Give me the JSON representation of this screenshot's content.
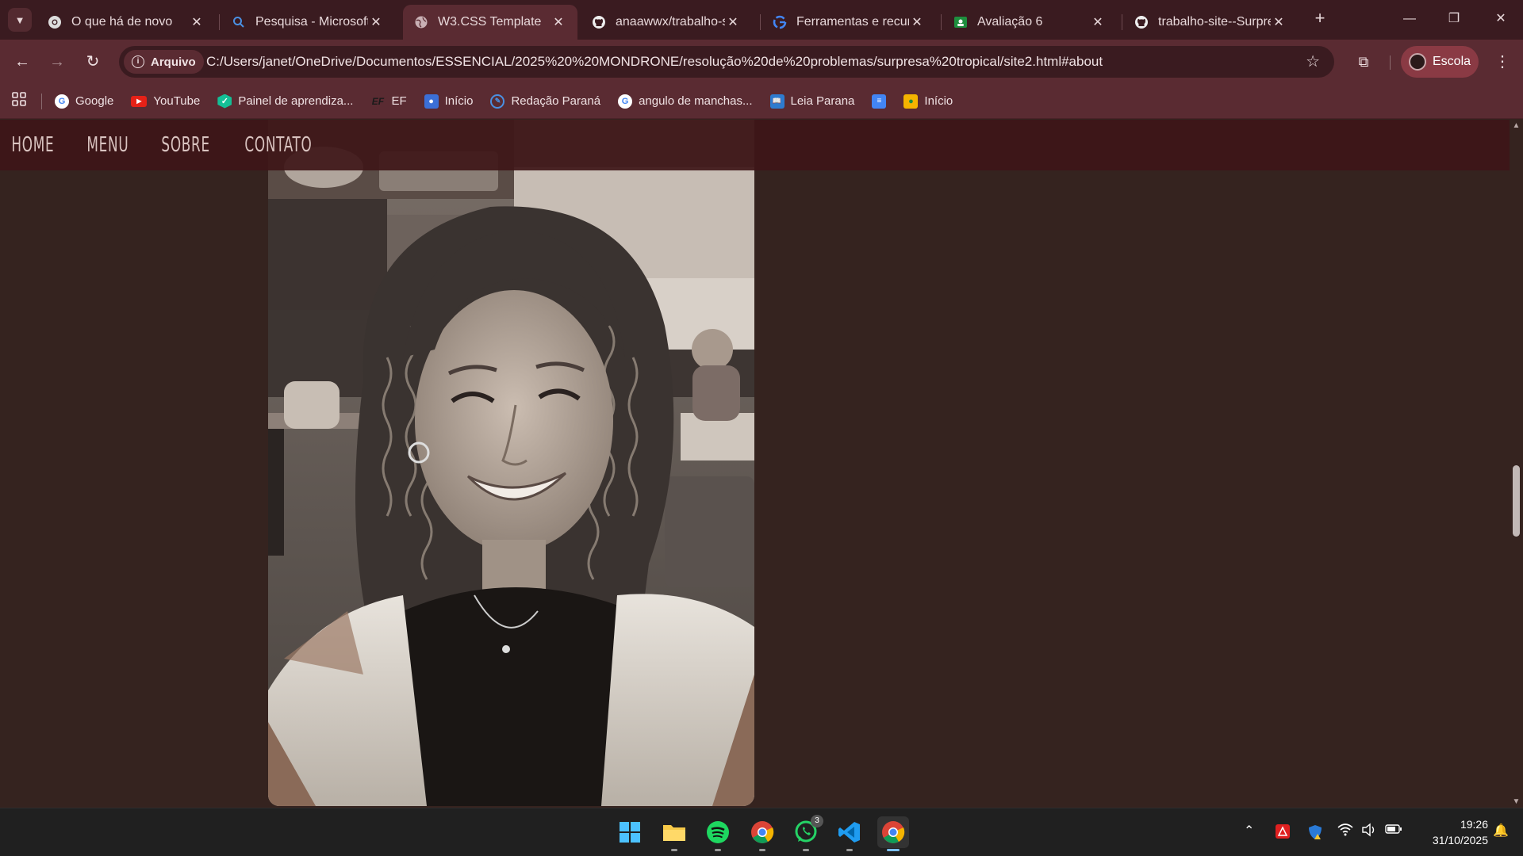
{
  "browser": {
    "tabs": [
      {
        "title": "O que há de novo",
        "favicon": "chrome-icon",
        "active": false
      },
      {
        "title": "Pesquisa - Microsoft",
        "favicon": "search-icon",
        "active": false
      },
      {
        "title": "W3.CSS Template",
        "favicon": "globe-icon",
        "active": true
      },
      {
        "title": "anaawwx/trabalho-si",
        "favicon": "github-icon",
        "active": false
      },
      {
        "title": "Ferramentas e recurs",
        "favicon": "google-icon",
        "active": false
      },
      {
        "title": "Avaliação 6",
        "favicon": "classroom-icon",
        "active": false
      },
      {
        "title": "trabalho-site--Surpre",
        "favicon": "github-icon",
        "active": false
      }
    ],
    "address": {
      "chip": "Arquivo",
      "url": "C:/Users/janet/OneDrive/Documentos/ESSENCIAL/2025%20%20MONDRONE/resolução%20de%20problemas/surpresa%20tropical/site2.html#about"
    },
    "profile": "Escola",
    "bookmarks": [
      {
        "label": "Google",
        "icon": "google-icon"
      },
      {
        "label": "YouTube",
        "icon": "youtube-icon"
      },
      {
        "label": "Painel de aprendiza...",
        "icon": "khan-icon"
      },
      {
        "label": "EF",
        "icon": "ef-icon"
      },
      {
        "label": "Início",
        "icon": "classroom-icon"
      },
      {
        "label": "Redação Paraná",
        "icon": "redacao-icon"
      },
      {
        "label": "angulo de manchas...",
        "icon": "google-icon"
      },
      {
        "label": "Leia Parana",
        "icon": "book-icon"
      },
      {
        "label": "",
        "icon": "docs-icon"
      },
      {
        "label": "Início",
        "icon": "classroom-yellow-icon"
      }
    ]
  },
  "page": {
    "nav": [
      "HOME",
      "MENU",
      "SOBRE",
      "CONTATO"
    ]
  },
  "taskbar": {
    "whatsapp_badge": "3",
    "time": "19:26",
    "date": "31/10/2025"
  },
  "colors": {
    "page_bg": "#35231f",
    "nav_bg": "#3e1618",
    "tabstrip_bg": "#3a1b20",
    "toolbar_bg": "#5a2b32"
  }
}
